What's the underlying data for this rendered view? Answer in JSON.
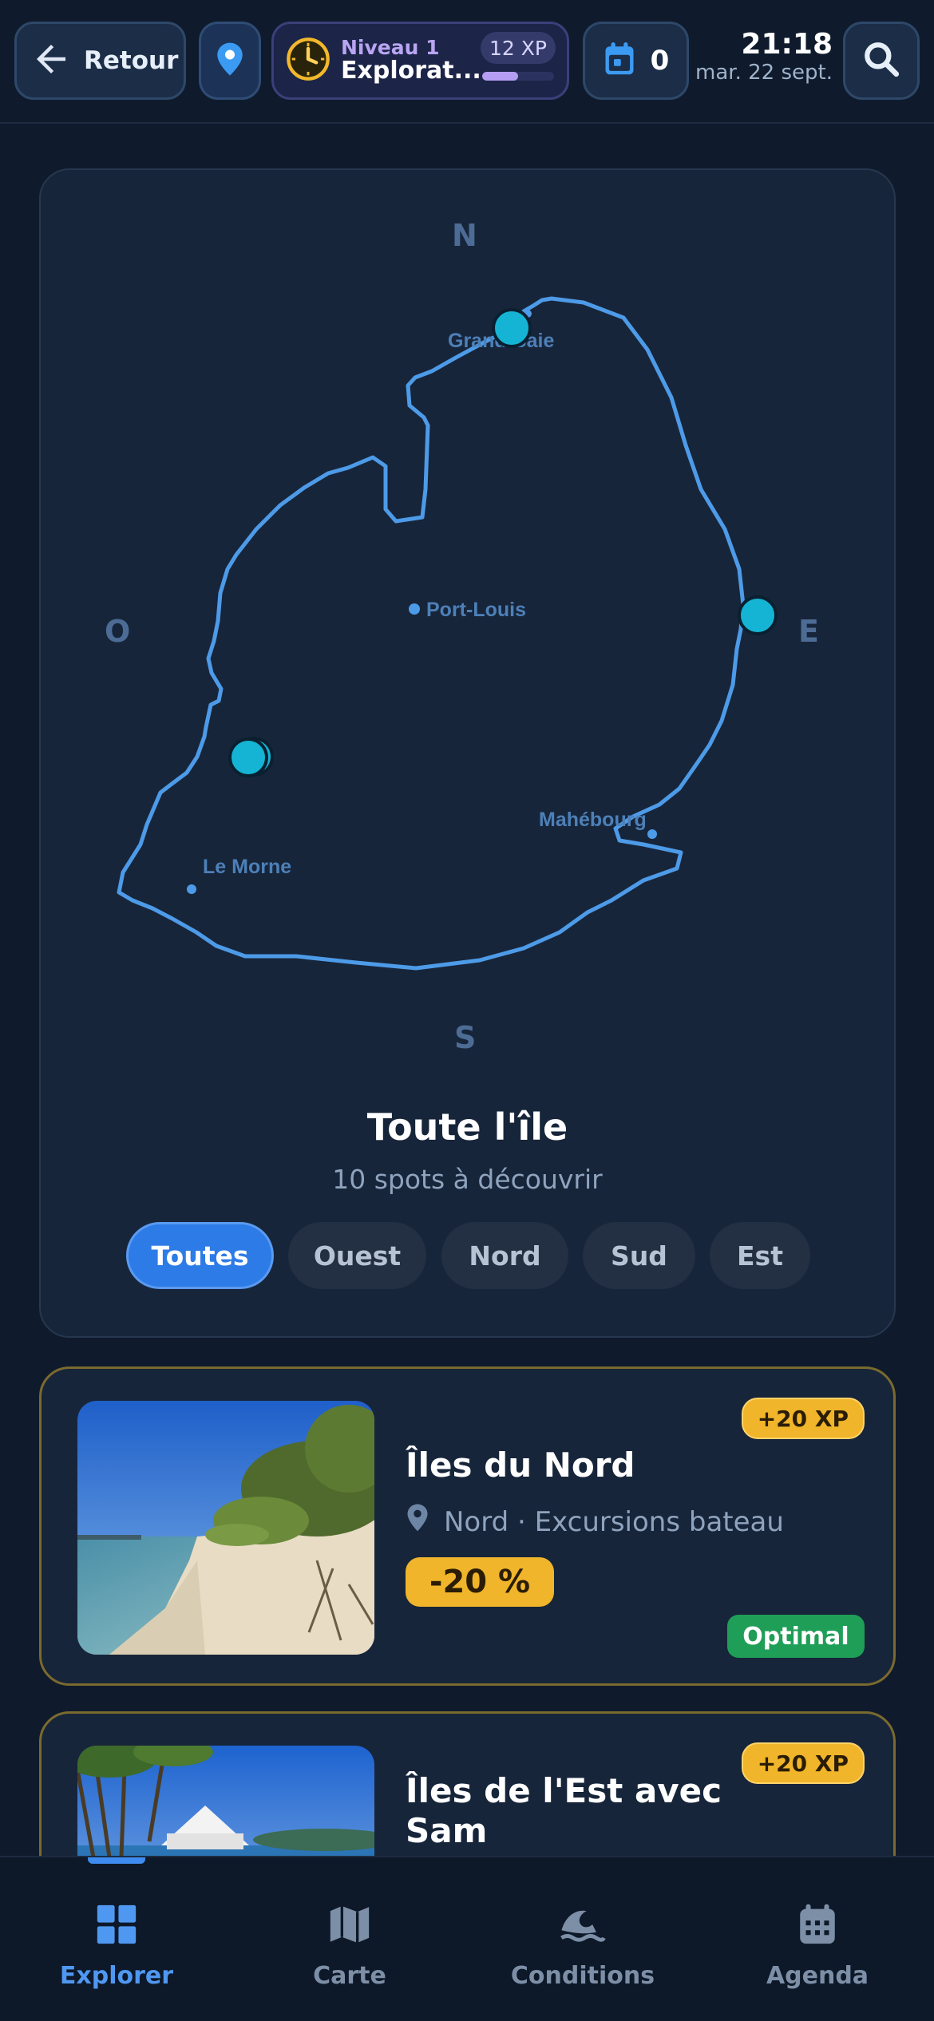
{
  "header": {
    "back_label": "Retour",
    "level_label": "Niveau 1",
    "level_name": "Explorat...",
    "xp_label": "12 XP",
    "xp_progress": 0.5,
    "calendar_count": "0",
    "time": "21:18",
    "date": "mar. 22 sept."
  },
  "map": {
    "compass": {
      "north": "N",
      "south": "S",
      "west": "O",
      "east": "E"
    },
    "places": [
      "Grand Baie",
      "Port-Louis",
      "Mahébourg",
      "Le Morne"
    ],
    "title": "Toute l'île",
    "subtitle": "10 spots à découvrir",
    "filters": [
      "Toutes",
      "Ouest",
      "Nord",
      "Sud",
      "Est"
    ],
    "active_filter": "Toutes"
  },
  "spots": [
    {
      "title": "Îles du Nord",
      "xp": "+20 XP",
      "meta": "Nord · Excursions bateau",
      "promo": "-20 %",
      "status": "Optimal"
    },
    {
      "title_line1": "Îles de l'Est avec",
      "title_line2": "Sam",
      "xp": "+20 XP"
    }
  ],
  "nav": {
    "items": [
      "Explorer",
      "Carte",
      "Conditions",
      "Agenda"
    ],
    "active": "Explorer"
  },
  "colors": {
    "background": "#0f1b2c",
    "card": "#17253a",
    "accent": "#2d7be6",
    "marker": "#15b4d4",
    "gold": "#f0b52a",
    "success": "#1f9e57"
  }
}
